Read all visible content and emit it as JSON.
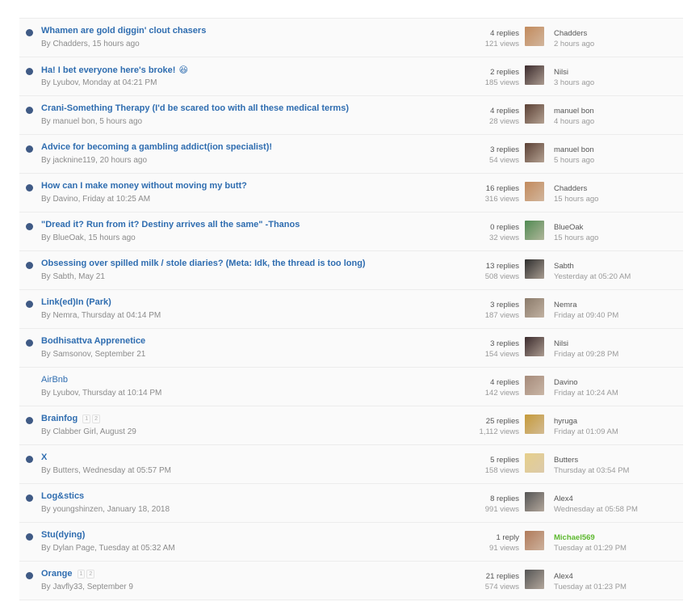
{
  "threads": [
    {
      "title": "Whamen are gold diggin' clout chasers",
      "meta": "By Chadders, 15 hours ago",
      "replies": "4 replies",
      "views": "121 views",
      "last_user": "Chadders",
      "last_time": "2 hours ago",
      "unread": true,
      "avatar_color": "#c28a5c",
      "emoji": "",
      "pages": []
    },
    {
      "title": "Ha! I bet everyone here's broke!",
      "meta": "By Lyubov, Monday at 04:21 PM",
      "replies": "2 replies",
      "views": "185 views",
      "last_user": "Nilsi",
      "last_time": "3 hours ago",
      "unread": true,
      "avatar_color": "#3b2b2d",
      "emoji": "😆",
      "pages": []
    },
    {
      "title": "Crani-Something Therapy (I'd be scared too with all these medical terms)",
      "meta": "By manuel bon, 5 hours ago",
      "replies": "4 replies",
      "views": "28 views",
      "last_user": "manuel bon",
      "last_time": "4 hours ago",
      "unread": true,
      "avatar_color": "#5a4034",
      "emoji": "",
      "pages": []
    },
    {
      "title": "Advice for becoming a gambling addict(ion specialist)!",
      "meta": "By jacknine119, 20 hours ago",
      "replies": "3 replies",
      "views": "54 views",
      "last_user": "manuel bon",
      "last_time": "5 hours ago",
      "unread": true,
      "avatar_color": "#5a4034",
      "emoji": "",
      "pages": []
    },
    {
      "title": "How can I make money without moving my butt?",
      "meta": "By Davino, Friday at 10:25 AM",
      "replies": "16 replies",
      "views": "316 views",
      "last_user": "Chadders",
      "last_time": "15 hours ago",
      "unread": true,
      "avatar_color": "#c28a5c",
      "emoji": "",
      "pages": []
    },
    {
      "title": "\"Dread it? Run from it? Destiny arrives all the same\" -Thanos",
      "meta": "By BlueOak, 15 hours ago",
      "replies": "0 replies",
      "views": "32 views",
      "last_user": "BlueOak",
      "last_time": "15 hours ago",
      "unread": true,
      "avatar_color": "#4f8a52",
      "emoji": "",
      "pages": []
    },
    {
      "title": "Obsessing over spilled milk / stole diaries? (Meta: Idk, the thread is too long)",
      "meta": "By Sabth, May 21",
      "replies": "13 replies",
      "views": "508 views",
      "last_user": "Sabth",
      "last_time": "Yesterday at 05:20 AM",
      "unread": true,
      "avatar_color": "#2e2e2e",
      "emoji": "",
      "pages": []
    },
    {
      "title": "Link(ed)In (Park)",
      "meta": "By Nemra, Thursday at 04:14 PM",
      "replies": "3 replies",
      "views": "187 views",
      "last_user": "Nemra",
      "last_time": "Friday at 09:40 PM",
      "unread": true,
      "avatar_color": "#8a7a6a",
      "emoji": "",
      "pages": []
    },
    {
      "title": "Bodhisattva Apprenetice",
      "meta": "By Samsonov, September 21",
      "replies": "3 replies",
      "views": "154 views",
      "last_user": "Nilsi",
      "last_time": "Friday at 09:28 PM",
      "unread": true,
      "avatar_color": "#3b2b2d",
      "emoji": "",
      "pages": []
    },
    {
      "title": "AirBnb",
      "meta": "By Lyubov, Thursday at 10:14 PM",
      "replies": "4 replies",
      "views": "142 views",
      "last_user": "Davino",
      "last_time": "Friday at 10:24 AM",
      "unread": false,
      "avatar_color": "#a58a7a",
      "emoji": "",
      "pages": []
    },
    {
      "title": "Brainfog",
      "meta": "By Clabber Girl, August 29",
      "replies": "25 replies",
      "views": "1,112 views",
      "last_user": "hyruga",
      "last_time": "Friday at 01:09 AM",
      "unread": true,
      "avatar_color": "#c59a3a",
      "emoji": "",
      "pages": [
        "1",
        "2"
      ]
    },
    {
      "title": "X",
      "meta": "By Butters, Wednesday at 05:57 PM",
      "replies": "5 replies",
      "views": "158 views",
      "last_user": "Butters",
      "last_time": "Thursday at 03:54 PM",
      "unread": true,
      "avatar_color": "#e6cf8a",
      "emoji": "",
      "pages": []
    },
    {
      "title": "Log&stics",
      "meta": "By youngshinzen, January 18, 2018",
      "replies": "8 replies",
      "views": "991 views",
      "last_user": "Alex4",
      "last_time": "Wednesday at 05:58 PM",
      "unread": true,
      "avatar_color": "#555555",
      "emoji": "",
      "pages": []
    },
    {
      "title": "Stu(dying)",
      "meta": "By Dylan Page, Tuesday at 05:32 AM",
      "replies": "1 reply",
      "views": "91 views",
      "last_user": "Michael569",
      "last_time": "Tuesday at 01:29 PM",
      "unread": true,
      "avatar_color": "#b07a5a",
      "emoji": "",
      "pages": [],
      "last_user_green": true
    },
    {
      "title": "Orange",
      "meta": "By Javfly33, September 9",
      "replies": "21 replies",
      "views": "574 views",
      "last_user": "Alex4",
      "last_time": "Tuesday at 01:23 PM",
      "unread": true,
      "avatar_color": "#555555",
      "emoji": "",
      "pages": [
        "1",
        "2"
      ]
    }
  ]
}
